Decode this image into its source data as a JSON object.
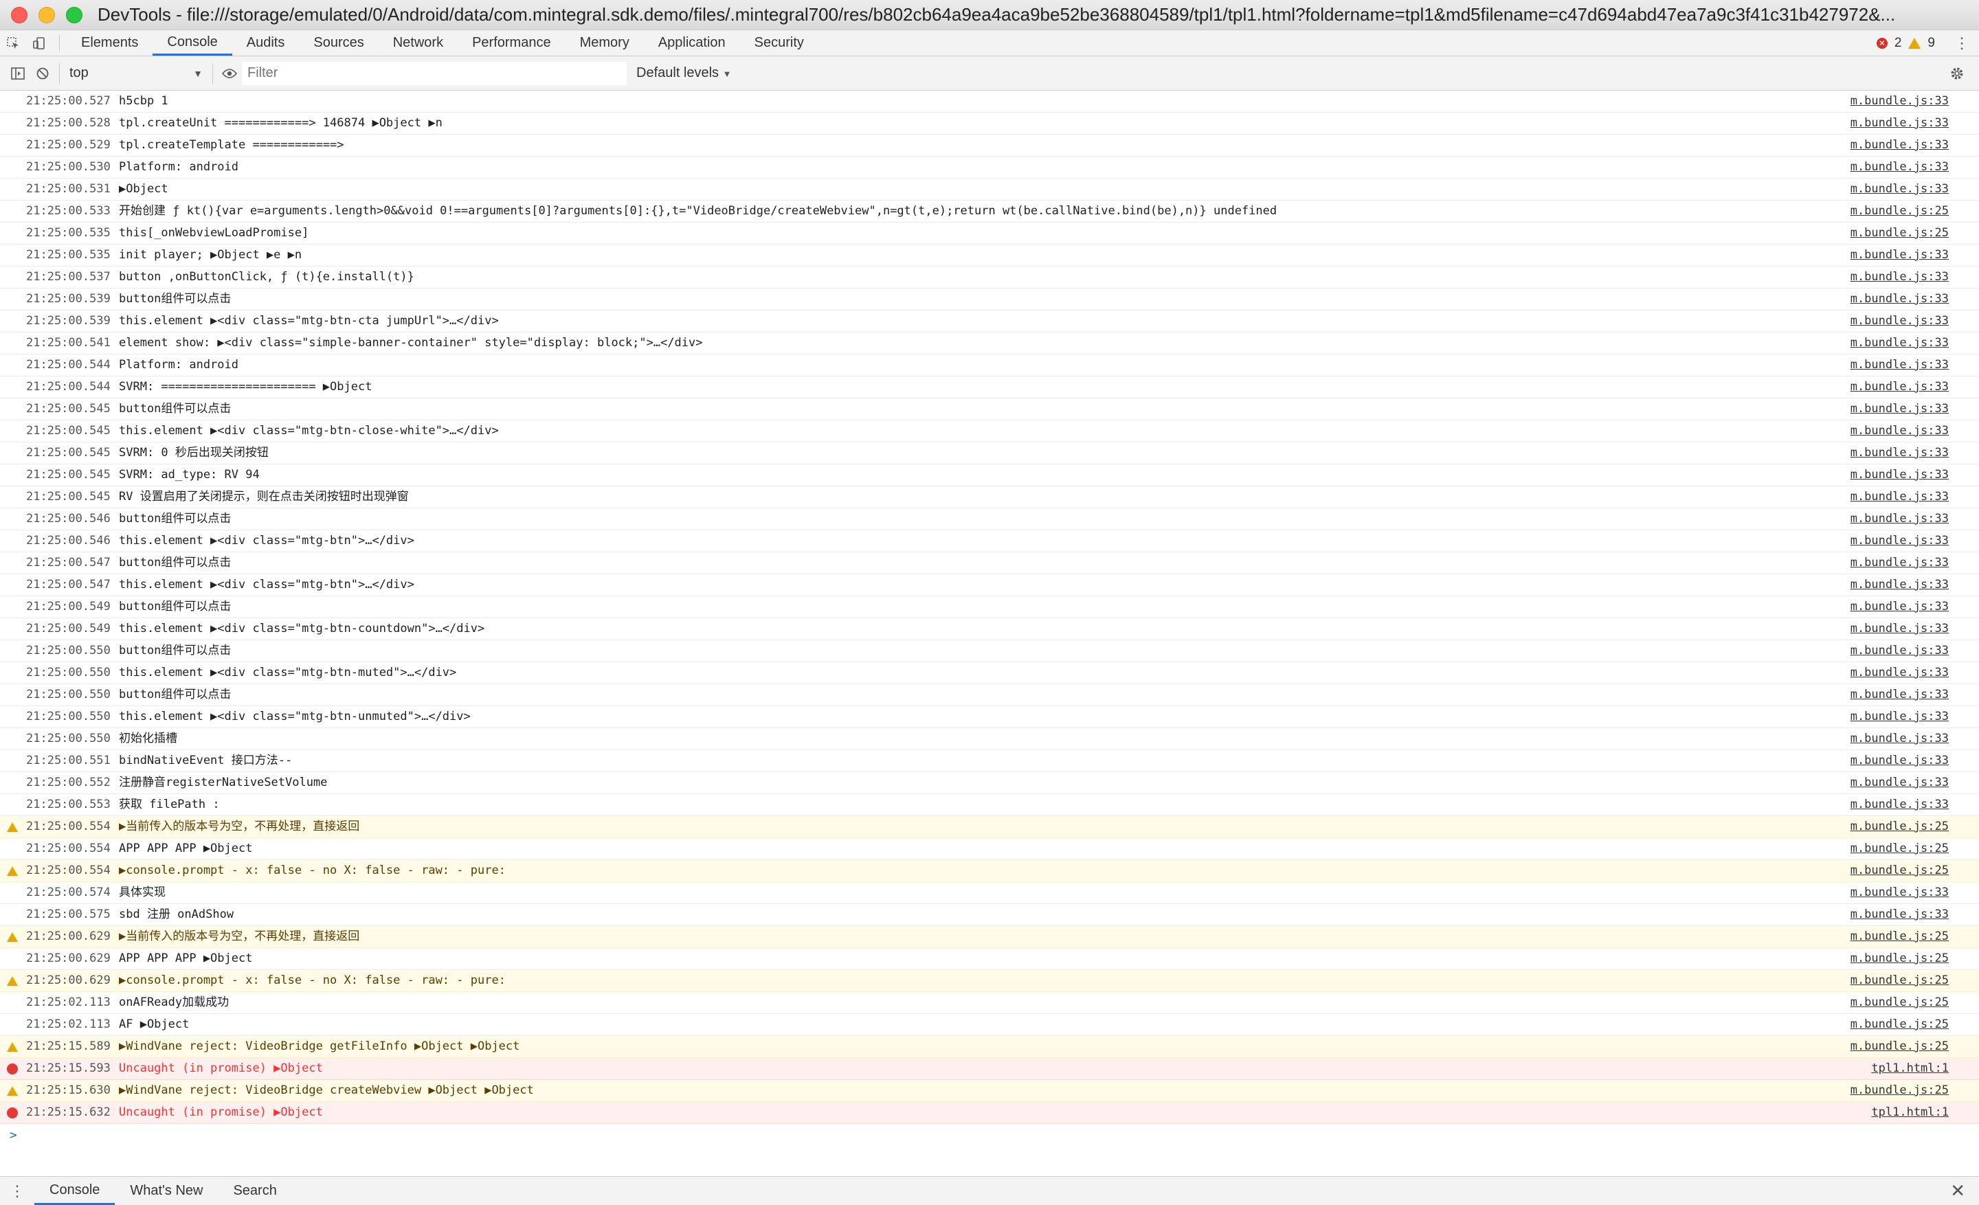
{
  "window": {
    "title": "DevTools - file:///storage/emulated/0/Android/data/com.mintegral.sdk.demo/files/.mintegral700/res/b802cb64a9ea4aca9be52be368804589/tpl1/tpl1.html?foldername=tpl1&md5filename=c47d694abd47ea7a9c3f41c31b427972&..."
  },
  "tabs": [
    {
      "label": "Elements",
      "active": false
    },
    {
      "label": "Console",
      "active": true
    },
    {
      "label": "Audits",
      "active": false
    },
    {
      "label": "Sources",
      "active": false
    },
    {
      "label": "Network",
      "active": false
    },
    {
      "label": "Performance",
      "active": false
    },
    {
      "label": "Memory",
      "active": false
    },
    {
      "label": "Application",
      "active": false
    },
    {
      "label": "Security",
      "active": false
    }
  ],
  "status": {
    "errors": "2",
    "warnings": "9"
  },
  "toolbar": {
    "context": "top",
    "filter_placeholder": "Filter",
    "levels": "Default levels"
  },
  "messages": [
    {
      "level": "info",
      "time": "21:25:00.527",
      "text": "h5cbp 1",
      "source": "m.bundle.js:33"
    },
    {
      "level": "info",
      "time": "21:25:00.528",
      "text": "tpl.createUnit ============> 146874 ▶Object ▶n",
      "source": "m.bundle.js:33"
    },
    {
      "level": "info",
      "time": "21:25:00.529",
      "text": "tpl.createTemplate ============>",
      "source": "m.bundle.js:33"
    },
    {
      "level": "info",
      "time": "21:25:00.530",
      "text": "Platform: android",
      "source": "m.bundle.js:33"
    },
    {
      "level": "info",
      "time": "21:25:00.531",
      "text": "▶Object",
      "source": "m.bundle.js:33"
    },
    {
      "level": "info",
      "time": "21:25:00.533",
      "text": "开始创建 ƒ kt(){var e=arguments.length>0&&void 0!==arguments[0]?arguments[0]:{},t=\"VideoBridge/createWebview\",n=gt(t,e);return wt(be.callNative.bind(be),n)} undefined",
      "source": "m.bundle.js:25"
    },
    {
      "level": "info",
      "time": "21:25:00.535",
      "text": "this[_onWebviewLoadPromise]",
      "source": "m.bundle.js:25"
    },
    {
      "level": "info",
      "time": "21:25:00.535",
      "text": "init player;  ▶Object ▶e ▶n",
      "source": "m.bundle.js:33"
    },
    {
      "level": "info",
      "time": "21:25:00.537",
      "text": "button ,onButtonClick, ƒ (t){e.install(t)}",
      "source": "m.bundle.js:33"
    },
    {
      "level": "info",
      "time": "21:25:00.539",
      "text": "button组件可以点击",
      "source": "m.bundle.js:33"
    },
    {
      "level": "info",
      "time": "21:25:00.539",
      "text": " this.element  ▶<div class=\"mtg-btn-cta jumpUrl\">…</div>",
      "source": "m.bundle.js:33"
    },
    {
      "level": "info",
      "time": "21:25:00.541",
      "text": "element show:  ▶<div class=\"simple-banner-container\" style=\"display: block;\">…</div>",
      "source": "m.bundle.js:33"
    },
    {
      "level": "info",
      "time": "21:25:00.544",
      "text": "Platform: android",
      "source": "m.bundle.js:33"
    },
    {
      "level": "info",
      "time": "21:25:00.544",
      "text": "SVRM:  ====================== ▶Object",
      "source": "m.bundle.js:33"
    },
    {
      "level": "info",
      "time": "21:25:00.545",
      "text": "button组件可以点击",
      "source": "m.bundle.js:33"
    },
    {
      "level": "info",
      "time": "21:25:00.545",
      "text": " this.element  ▶<div class=\"mtg-btn-close-white\">…</div>",
      "source": "m.bundle.js:33"
    },
    {
      "level": "info",
      "time": "21:25:00.545",
      "text": "SVRM:  0 秒后出现关闭按钮",
      "source": "m.bundle.js:33"
    },
    {
      "level": "info",
      "time": "21:25:00.545",
      "text": "SVRM:  ad_type: RV  94",
      "source": "m.bundle.js:33"
    },
    {
      "level": "info",
      "time": "21:25:00.545",
      "text": "RV 设置启用了关闭提示，则在点击关闭按钮时出现弹窗",
      "source": "m.bundle.js:33"
    },
    {
      "level": "info",
      "time": "21:25:00.546",
      "text": "button组件可以点击",
      "source": "m.bundle.js:33"
    },
    {
      "level": "info",
      "time": "21:25:00.546",
      "text": " this.element  ▶<div class=\"mtg-btn\">…</div>",
      "source": "m.bundle.js:33"
    },
    {
      "level": "info",
      "time": "21:25:00.547",
      "text": "button组件可以点击",
      "source": "m.bundle.js:33"
    },
    {
      "level": "info",
      "time": "21:25:00.547",
      "text": " this.element  ▶<div class=\"mtg-btn\">…</div>",
      "source": "m.bundle.js:33"
    },
    {
      "level": "info",
      "time": "21:25:00.549",
      "text": "button组件可以点击",
      "source": "m.bundle.js:33"
    },
    {
      "level": "info",
      "time": "21:25:00.549",
      "text": " this.element  ▶<div class=\"mtg-btn-countdown\">…</div>",
      "source": "m.bundle.js:33"
    },
    {
      "level": "info",
      "time": "21:25:00.550",
      "text": "button组件可以点击",
      "source": "m.bundle.js:33"
    },
    {
      "level": "info",
      "time": "21:25:00.550",
      "text": " this.element  ▶<div class=\"mtg-btn-muted\">…</div>",
      "source": "m.bundle.js:33"
    },
    {
      "level": "info",
      "time": "21:25:00.550",
      "text": "button组件可以点击",
      "source": "m.bundle.js:33"
    },
    {
      "level": "info",
      "time": "21:25:00.550",
      "text": " this.element  ▶<div class=\"mtg-btn-unmuted\">…</div>",
      "source": "m.bundle.js:33"
    },
    {
      "level": "info",
      "time": "21:25:00.550",
      "text": "初始化插槽",
      "source": "m.bundle.js:33"
    },
    {
      "level": "info",
      "time": "21:25:00.551",
      "text": "bindNativeEvent 接口方法--",
      "source": "m.bundle.js:33"
    },
    {
      "level": "info",
      "time": "21:25:00.552",
      "text": "注册静音registerNativeSetVolume",
      "source": "m.bundle.js:33"
    },
    {
      "level": "info",
      "time": "21:25:00.553",
      "text": "获取 filePath :",
      "source": "m.bundle.js:33"
    },
    {
      "level": "warn",
      "time": "21:25:00.554",
      "text": "▶当前传入的版本号为空，不再处理，直接返回",
      "source": "m.bundle.js:25"
    },
    {
      "level": "info",
      "time": "21:25:00.554",
      "text": "APP APP APP ▶Object",
      "source": "m.bundle.js:25"
    },
    {
      "level": "warn",
      "time": "21:25:00.554",
      "text": "▶console.prompt - x:  false  - no X: false  - raw:    - pure:",
      "source": "m.bundle.js:25"
    },
    {
      "level": "info",
      "time": "21:25:00.574",
      "text": "具体实现",
      "source": "m.bundle.js:33"
    },
    {
      "level": "info",
      "time": "21:25:00.575",
      "text": "sbd 注册 onAdShow",
      "source": "m.bundle.js:33"
    },
    {
      "level": "warn",
      "time": "21:25:00.629",
      "text": "▶当前传入的版本号为空，不再处理，直接返回",
      "source": "m.bundle.js:25"
    },
    {
      "level": "info",
      "time": "21:25:00.629",
      "text": "APP APP APP ▶Object",
      "source": "m.bundle.js:25"
    },
    {
      "level": "warn",
      "time": "21:25:00.629",
      "text": "▶console.prompt - x:  false  - no X: false  - raw:    - pure:",
      "source": "m.bundle.js:25"
    },
    {
      "level": "info",
      "time": "21:25:02.113",
      "text": "onAFReady加载成功",
      "source": "m.bundle.js:25"
    },
    {
      "level": "info",
      "time": "21:25:02.113",
      "text": "AF ▶Object",
      "source": "m.bundle.js:25"
    },
    {
      "level": "warn",
      "time": "21:25:15.589",
      "text": "▶WindVane reject:  VideoBridge getFileInfo ▶Object ▶Object",
      "source": "m.bundle.js:25"
    },
    {
      "level": "error",
      "time": "21:25:15.593",
      "text": "Uncaught (in promise) ▶Object",
      "source": "tpl1.html:1"
    },
    {
      "level": "warn",
      "time": "21:25:15.630",
      "text": "▶WindVane reject:  VideoBridge createWebview ▶Object ▶Object",
      "source": "m.bundle.js:25"
    },
    {
      "level": "error",
      "time": "21:25:15.632",
      "text": "Uncaught (in promise) ▶Object",
      "source": "tpl1.html:1"
    }
  ],
  "prompt": ">",
  "drawer": {
    "tabs": [
      {
        "label": "Console",
        "active": true
      },
      {
        "label": "What's New",
        "active": false
      },
      {
        "label": "Search",
        "active": false
      }
    ]
  },
  "icons": {
    "inspect": "inspect-element-icon",
    "device": "device-toolbar-icon",
    "sidebar": "show-sidebar-icon",
    "clear": "clear-console-icon",
    "eye": "live-expression-icon",
    "settings": "gear-icon",
    "more": "kebab-menu-icon",
    "close": "close-icon"
  },
  "colors": {
    "accent": "#1a73e8",
    "warn_bg": "#fffbe6",
    "error_bg": "#fff0f0",
    "error_text": "#fe2f2f",
    "warn_icon": "#e8a600",
    "error_icon": "#e53935"
  }
}
